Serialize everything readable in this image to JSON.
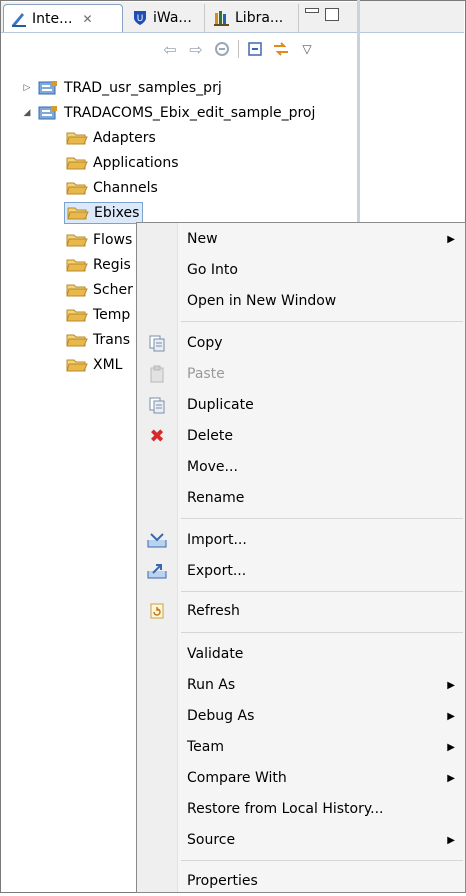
{
  "tabs": [
    {
      "label": "Inte...",
      "icon": "integration-explorer-icon",
      "active": true
    },
    {
      "label": "iWa...",
      "icon": "iway-shield-icon"
    },
    {
      "label": "Libra...",
      "icon": "library-books-icon"
    }
  ],
  "tree": {
    "projects": [
      {
        "label": "TRAD_usr_samples_prj",
        "expanded": false
      },
      {
        "label": "TRADACOMS_Ebix_edit_sample_proj",
        "expanded": true
      }
    ],
    "folders": [
      {
        "label": "Adapters"
      },
      {
        "label": "Applications"
      },
      {
        "label": "Channels"
      },
      {
        "label": "Ebixes",
        "selected": true
      },
      {
        "label": "Flows"
      },
      {
        "label": "Regis"
      },
      {
        "label": "Scher"
      },
      {
        "label": "Temp"
      },
      {
        "label": "Trans"
      },
      {
        "label": "XML"
      }
    ]
  },
  "menu": {
    "new": "New",
    "go_into": "Go Into",
    "open_new_window": "Open in New Window",
    "copy": "Copy",
    "paste": "Paste",
    "duplicate": "Duplicate",
    "delete": "Delete",
    "move": "Move...",
    "rename": "Rename",
    "import": "Import...",
    "export": "Export...",
    "refresh": "Refresh",
    "validate": "Validate",
    "run_as": "Run As",
    "debug_as": "Debug As",
    "team": "Team",
    "compare_with": "Compare With",
    "restore_history": "Restore from Local History...",
    "source": "Source",
    "properties": "Properties"
  },
  "colors": {
    "selection": "#dce9fb",
    "delete_red": "#d42a2a",
    "folder_yellow": "#e8b84a"
  }
}
